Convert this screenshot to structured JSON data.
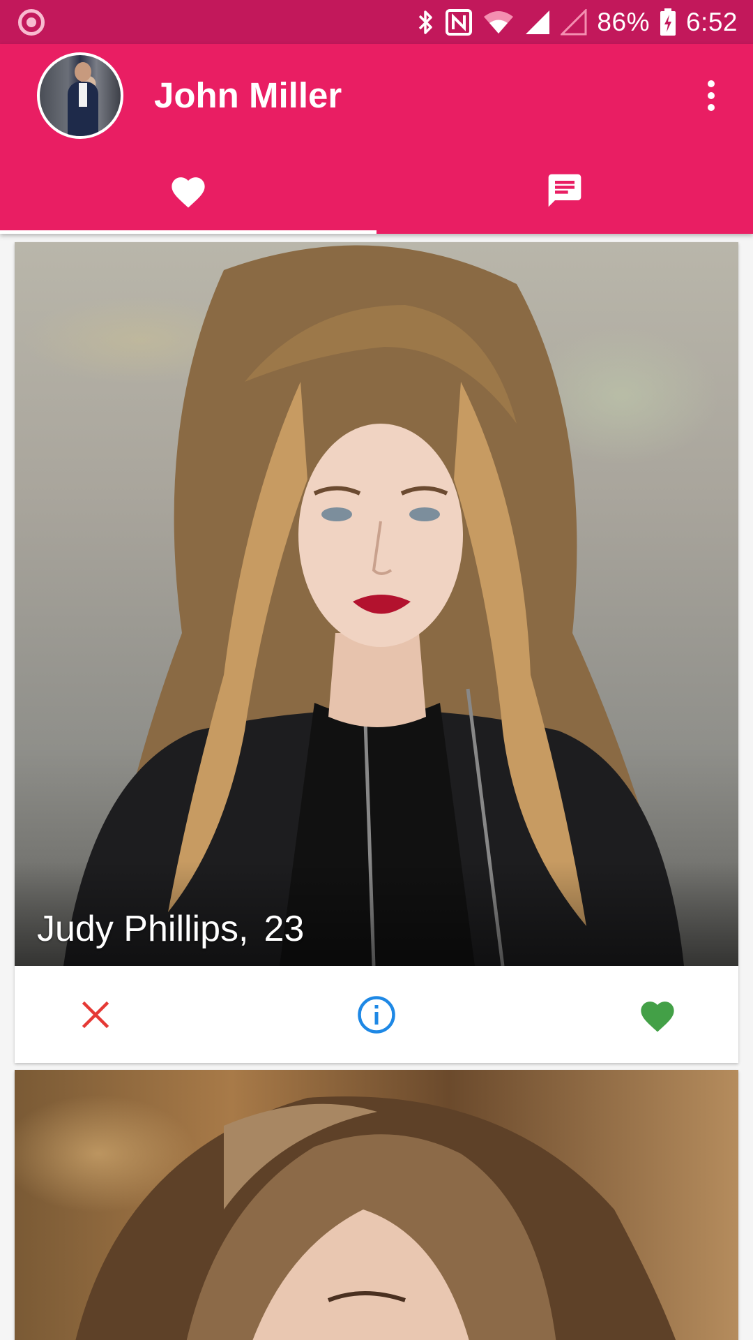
{
  "status_bar": {
    "battery": "86%",
    "time": "6:52",
    "icons": [
      "record-icon",
      "bluetooth-icon",
      "nfc-icon",
      "wifi-icon",
      "signal-icon",
      "signal-empty-icon",
      "battery-charging-icon"
    ]
  },
  "app_bar": {
    "title": "John Miller",
    "avatar_icon": "profile-avatar",
    "menu_icon": "more-vert-icon",
    "tabs": [
      {
        "icon": "heart-icon",
        "active": true
      },
      {
        "icon": "chat-icon",
        "active": false
      }
    ]
  },
  "colors": {
    "status_bar": "#c2185b",
    "primary": "#e91e63",
    "dislike": "#e53935",
    "info": "#1e88e5",
    "like": "#43a047"
  },
  "cards": [
    {
      "name": "Judy Phillips,",
      "age": "23",
      "actions": {
        "dislike_icon": "close-icon",
        "info_icon": "info-icon",
        "like_icon": "heart-icon"
      }
    },
    {
      "name": "",
      "age": ""
    }
  ]
}
